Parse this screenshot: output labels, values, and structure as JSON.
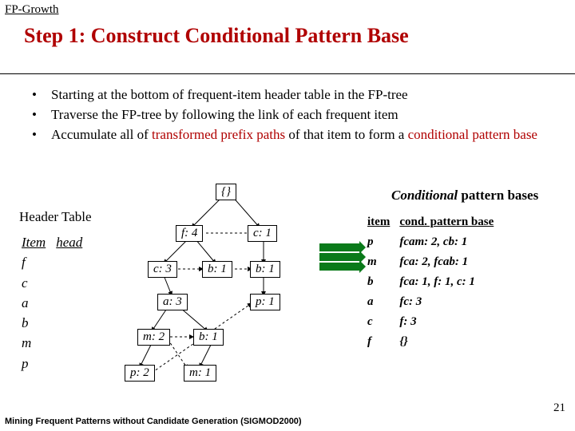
{
  "topic": "FP-Growth",
  "title": "Step 1: Construct Conditional Pattern Base",
  "bullets": [
    {
      "prefix": "Starting at the bottom of frequent-item header table in the FP-tree",
      "red": ""
    },
    {
      "prefix": "Traverse the FP-tree by following the link of each frequent item",
      "red": ""
    },
    {
      "prefix": "Accumulate all of ",
      "red": "transformed prefix paths",
      "mid": " of that item to form a ",
      "red2": "conditional pattern base"
    }
  ],
  "headerTable": {
    "label": "Header Table",
    "col1": "Item",
    "col2": "head",
    "items": [
      "f",
      "c",
      "a",
      "b",
      "m",
      "p"
    ]
  },
  "tree": {
    "root": "{}",
    "nodes": {
      "f4": "f: 4",
      "c1": "c: 1",
      "c3": "c: 3",
      "b1a": "b: 1",
      "b1b": "b: 1",
      "a3": "a: 3",
      "p1": "p: 1",
      "m2": "m: 2",
      "b1c": "b: 1",
      "p2": "p: 2",
      "m1": "m: 1"
    }
  },
  "cpb": {
    "titleItalic": "Conditional",
    "titleRest": " pattern bases",
    "cols": [
      "item",
      "cond. pattern base"
    ],
    "rows": [
      [
        "p",
        "fcam: 2, cb: 1"
      ],
      [
        "m",
        "fca: 2, fcab: 1"
      ],
      [
        "b",
        "fca: 1, f: 1, c: 1"
      ],
      [
        "a",
        "fc: 3"
      ],
      [
        "c",
        "f: 3"
      ],
      [
        "f",
        "{}"
      ]
    ]
  },
  "footer": "Mining Frequent Patterns without Candidate Generation (SIGMOD2000)",
  "slideNumber": "21"
}
